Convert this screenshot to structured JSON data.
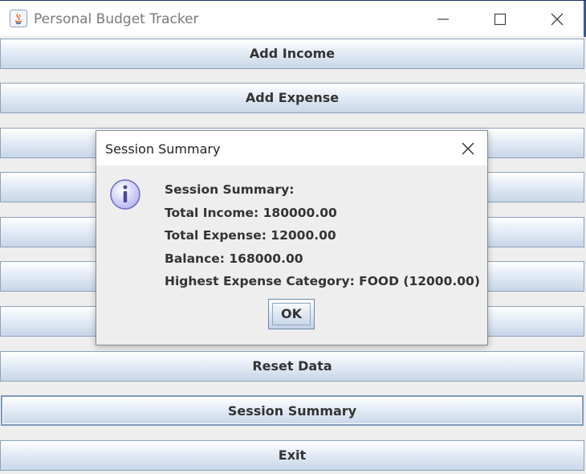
{
  "window": {
    "title": "Personal Budget Tracker",
    "controls": [
      "minimize-icon",
      "maximize-icon",
      "close-icon"
    ]
  },
  "buttons": [
    {
      "label": "Add Income"
    },
    {
      "label": "Add Expense"
    },
    {
      "label": ""
    },
    {
      "label": ""
    },
    {
      "label": ""
    },
    {
      "label": ""
    },
    {
      "label": ""
    },
    {
      "label": "Reset Data"
    },
    {
      "label": "Session Summary"
    },
    {
      "label": "Exit"
    }
  ],
  "dialog": {
    "title": "Session Summary",
    "icon": "info-icon",
    "lines": [
      "Session Summary:",
      "Total Income: 180000.00",
      "Total Expense: 12000.00",
      "Balance: 168000.00",
      "Highest Expense Category: FOOD (12000.00)"
    ],
    "ok_label": "OK"
  },
  "colors": {
    "button_top": "#ffffff",
    "button_bottom": "#c8d6e8",
    "button_border": "#8da2bd",
    "info_icon": "#b8b8f0"
  }
}
